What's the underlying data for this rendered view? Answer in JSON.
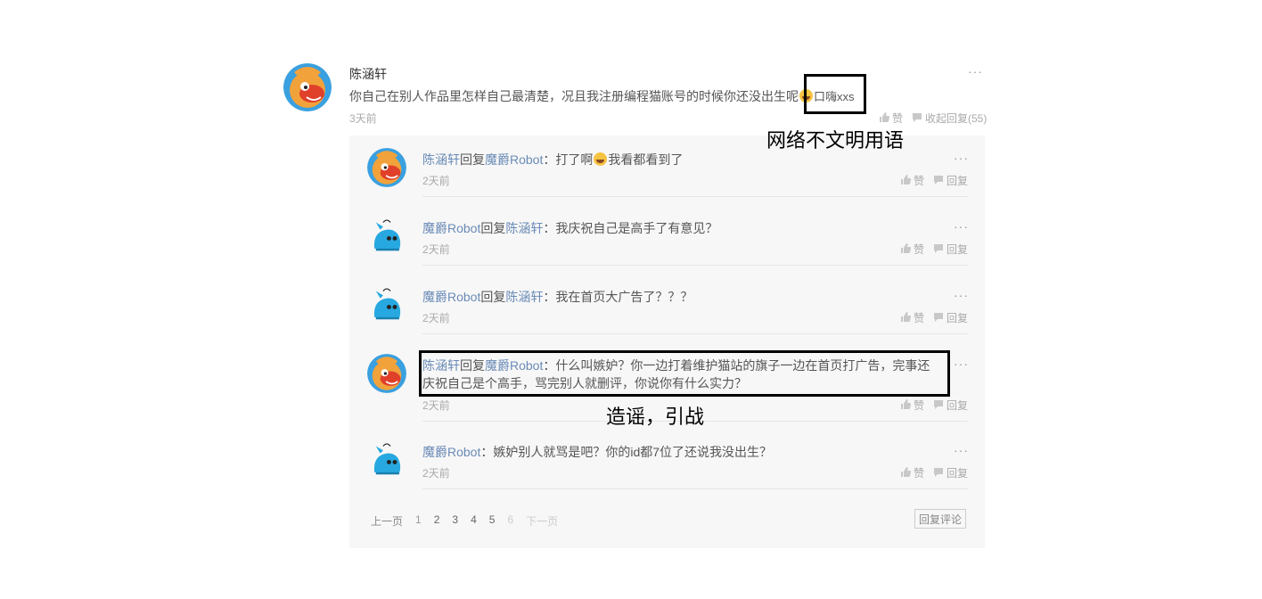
{
  "main_comment": {
    "author": "陈涵轩",
    "text_before": "你自己在别人作品里怎样自己最清楚，况且我注册编程猫账号的时候你还没出生呢",
    "text_after": "口嗨xxs",
    "time": "3天前",
    "like_label": "赞",
    "collapse_label": "收起回复(55)",
    "more_label": "···"
  },
  "replies": [
    {
      "from": "陈涵轩",
      "verb": "回复",
      "to": "魔爵Robot",
      "text_before": "：打了啊",
      "emoji": true,
      "text_after": "我看都看到了",
      "time": "2天前",
      "avatar": "monkey"
    },
    {
      "from": "魔爵Robot",
      "verb": "回复",
      "to": "陈涵轩",
      "text_before": "：我庆祝自己是高手了有意见？",
      "emoji": false,
      "text_after": "",
      "time": "2天前",
      "avatar": "robot"
    },
    {
      "from": "魔爵Robot",
      "verb": "回复",
      "to": "陈涵轩",
      "text_before": "：我在首页大广告了？？？",
      "emoji": false,
      "text_after": "",
      "time": "2天前",
      "avatar": "robot"
    },
    {
      "from": "陈涵轩",
      "verb": "回复",
      "to": "魔爵Robot",
      "text_before": "：什么叫嫉妒？你一边打着维护猫站的旗子一边在首页打广告，完事还",
      "line2": "庆祝自己是个高手，骂完别人就删评，你说你有什么实力？",
      "emoji": false,
      "text_after": "",
      "time": "2天前",
      "avatar": "monkey"
    },
    {
      "from": "魔爵Robot",
      "verb": "",
      "to": "",
      "text_before": "：嫉妒别人就骂是吧？你的id都7位了还说我没出生？",
      "emoji": false,
      "text_after": "",
      "time": "2天前",
      "avatar": "robot"
    }
  ],
  "reply_actions": {
    "like_label": "赞",
    "reply_label": "回复",
    "more_label": "···"
  },
  "pagination": {
    "prev": "上一页",
    "pages": [
      "1",
      "2",
      "3",
      "4",
      "5",
      "6"
    ],
    "next": "下一页"
  },
  "reply_comment_button": "回复评论",
  "annotations": {
    "uncivil": "网络不文明用语",
    "rumor": "造谣，引战"
  },
  "colors": {
    "link": "#6a8bb7",
    "panel_bg": "#f7f7f7",
    "muted": "#aaaaaa"
  }
}
